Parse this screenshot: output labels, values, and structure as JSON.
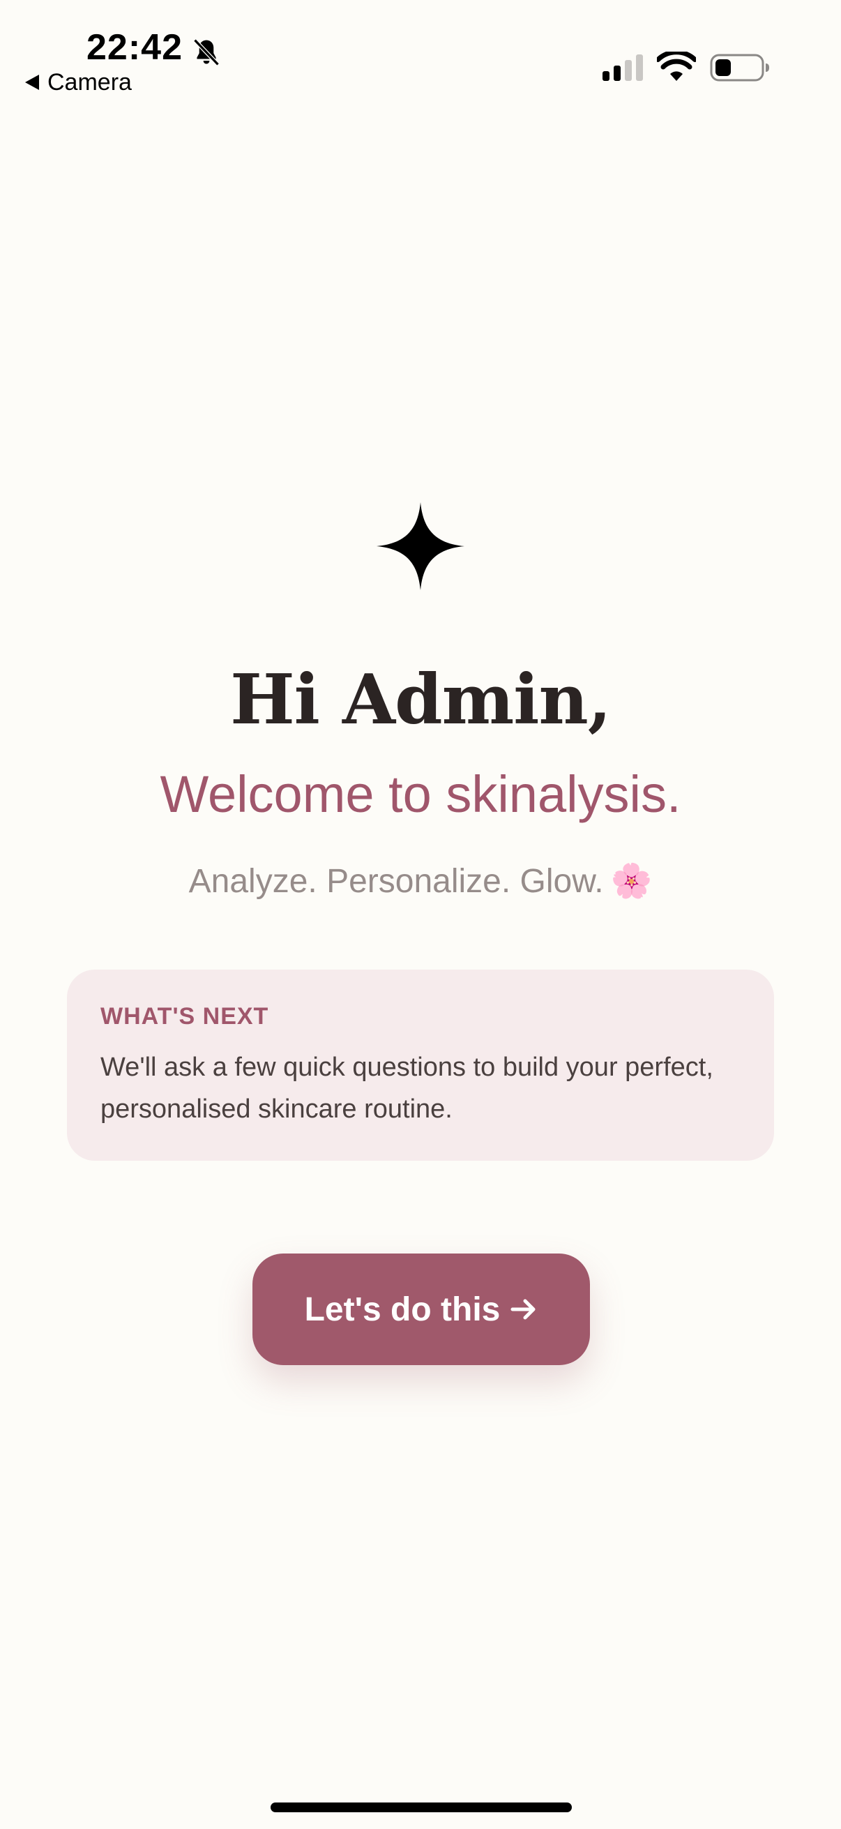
{
  "status_bar": {
    "time": "22:42",
    "back_app": "Camera",
    "icons": [
      "bell-slash-icon",
      "signal-icon",
      "wifi-icon",
      "battery-icon"
    ],
    "battery_level": 0.3
  },
  "welcome": {
    "icon": "sparkle-icon",
    "greeting": "Hi Admin,",
    "headline": "Welcome to skinalysis.",
    "tagline": "Analyze. Personalize. Glow.",
    "tagline_emoji": "🌸"
  },
  "next_card": {
    "title": "WHAT'S NEXT",
    "body": "We'll ask a few quick questions to build your perfect, personalised skincare routine."
  },
  "cta": {
    "label": "Let's do this",
    "icon": "arrow-right-icon"
  },
  "colors": {
    "background": "#fdfcf8",
    "accent": "#a0566b",
    "card_background": "#f6ebec",
    "heading": "#2b2423",
    "muted": "#968c8a"
  }
}
